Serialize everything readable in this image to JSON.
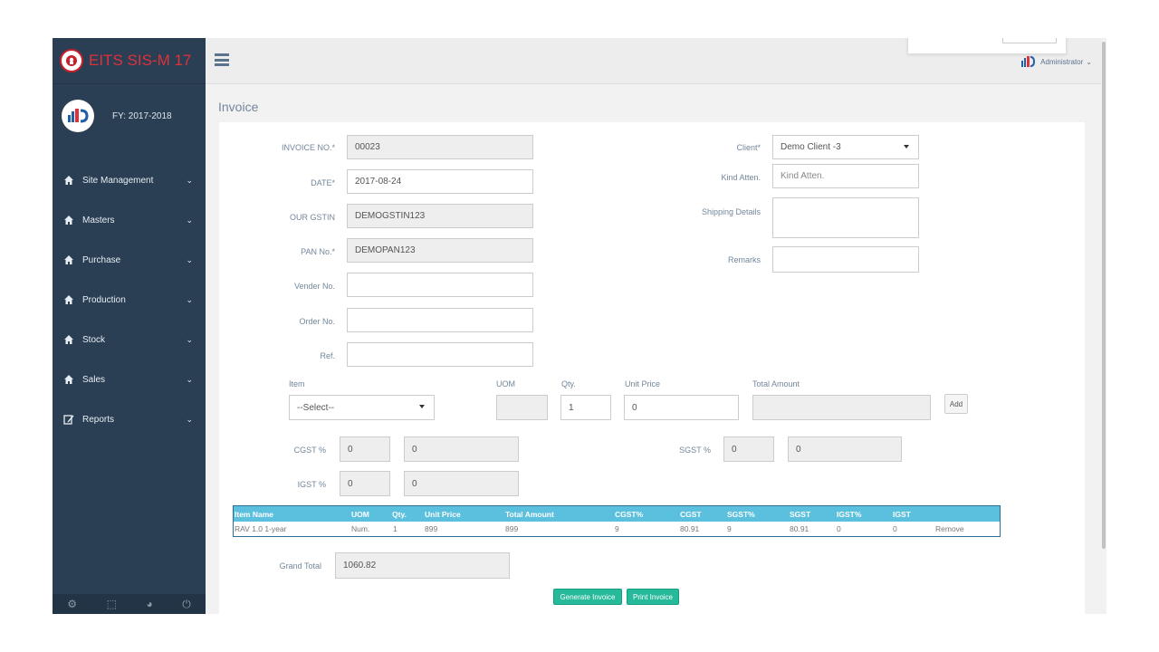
{
  "brand": {
    "title": "EITS SIS-M 17"
  },
  "profile": {
    "fy": "FY: 2017-2018"
  },
  "sidebar": {
    "items": [
      {
        "label": "Site Management"
      },
      {
        "label": "Masters"
      },
      {
        "label": "Purchase"
      },
      {
        "label": "Production"
      },
      {
        "label": "Stock"
      },
      {
        "label": "Sales"
      },
      {
        "label": "Reports"
      }
    ]
  },
  "topbar": {
    "user": "Administrator"
  },
  "page": {
    "title": "Invoice"
  },
  "form": {
    "invoice_no_label": "INVOICE NO.*",
    "invoice_no": "00023",
    "date_label": "DATE*",
    "date": "2017-08-24",
    "gstin_label": "OUR GSTIN",
    "gstin": "DEMOGSTIN123",
    "pan_label": "PAN No.*",
    "pan": "DEMOPAN123",
    "vender_label": "Vender No.",
    "order_label": "Order No.",
    "ref_label": "Ref.",
    "client_label": "Client*",
    "client": "Demo Client -3",
    "kind_label": "Kind Atten.",
    "kind_placeholder": "Kind Atten.",
    "shipping_label": "Shipping Details",
    "remarks_label": "Remarks"
  },
  "item_entry": {
    "item_label": "Item",
    "item_value": "--Select--",
    "uom_label": "UOM",
    "qty_label": "Qty.",
    "qty": "1",
    "unit_price_label": "Unit Price",
    "unit_price": "0",
    "total_label": "Total Amount",
    "add_label": "Add",
    "cgst_label": "CGST %",
    "cgst_pct": "0",
    "cgst_amt": "0",
    "sgst_label": "SGST %",
    "sgst_pct": "0",
    "sgst_amt": "0",
    "igst_label": "IGST %",
    "igst_pct": "0",
    "igst_amt": "0"
  },
  "table": {
    "headers": [
      "Item Name",
      "UOM",
      "Qty.",
      "Unit Price",
      "Total Amount",
      "CGST%",
      "CGST",
      "SGST%",
      "SGST",
      "IGST%",
      "IGST"
    ],
    "rows": [
      [
        "RAV 1.0 1-year",
        "Num.",
        "1",
        "899",
        "899",
        "9",
        "80.91",
        "9",
        "80.91",
        "0",
        "0",
        "Remove"
      ]
    ]
  },
  "totals": {
    "grand_label": "Grand Total",
    "grand_value": "1060.82"
  },
  "actions": {
    "generate": "Generate Invoice",
    "print": "Print Invoice"
  },
  "colors": {
    "sidebar": "#2a3f54",
    "table_header": "#5bc0de",
    "button_green": "#26b99a",
    "brand_red": "#e0303a"
  }
}
